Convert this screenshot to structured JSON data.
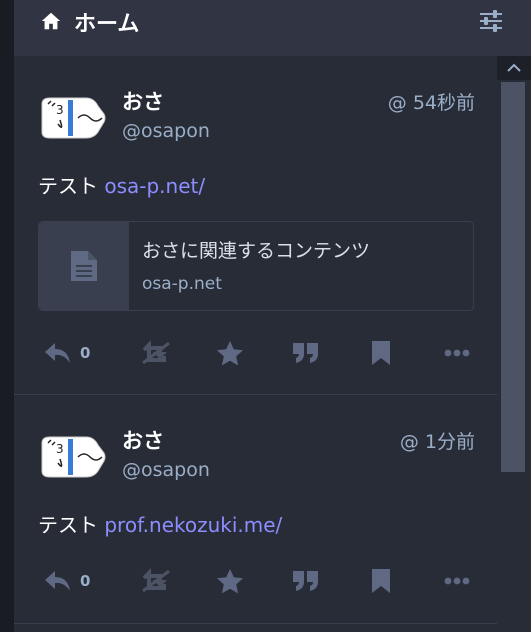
{
  "header": {
    "title": "ホーム"
  },
  "statuses": [
    {
      "display_name": "おさ",
      "acct": "@osapon",
      "time": "@ 54秒前",
      "text": "テスト ",
      "link": "osa-p.net/",
      "card": {
        "title": "おさに関連するコンテンツ",
        "host": "osa-p.net"
      },
      "reply_count": "0"
    },
    {
      "display_name": "おさ",
      "acct": "@osapon",
      "time": "@ 1分前",
      "text": "テスト ",
      "link": "prof.nekozuki.me/",
      "reply_count": "0"
    }
  ],
  "colors": {
    "accent": "#8c8dff",
    "muted": "#9baec8",
    "column": "#282c37",
    "header": "#313543"
  }
}
